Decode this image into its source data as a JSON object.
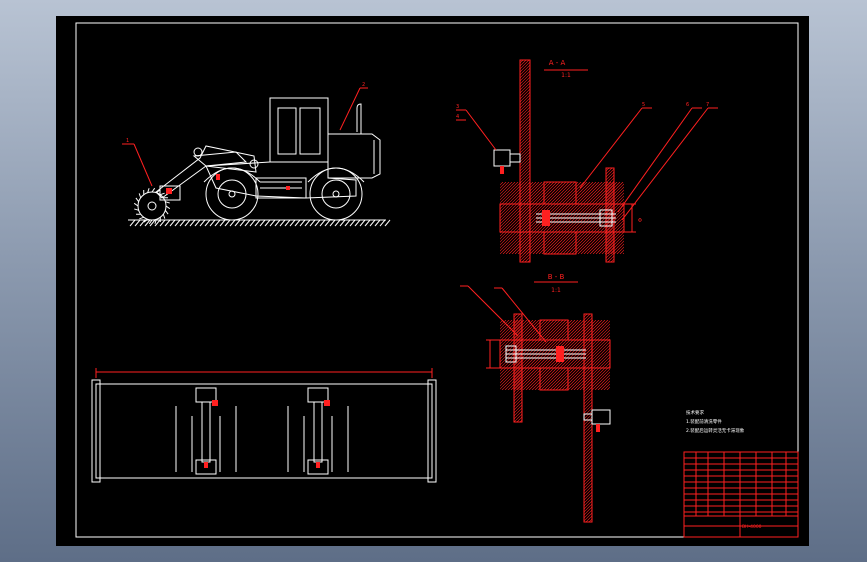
{
  "drawing": {
    "section_aa_title": "A - A",
    "section_aa_scale": "1:1",
    "section_bb_title": "B - B",
    "section_bb_scale": "1:1",
    "notes_heading": "技术要求",
    "notes_line1": "1.装配前清洗零件",
    "notes_line2": "2.装配后运转灵活无卡滞现象",
    "drawing_number": "BH-4000",
    "leader_labels": [
      "1",
      "2",
      "3",
      "4",
      "5",
      "6",
      "7"
    ]
  },
  "colors": {
    "background_sheet": "#000000",
    "outline": "#ffffff",
    "section": "#ff2020",
    "viewport_gradient_top": "#b8c3d3",
    "viewport_gradient_bottom": "#5e6e87"
  }
}
